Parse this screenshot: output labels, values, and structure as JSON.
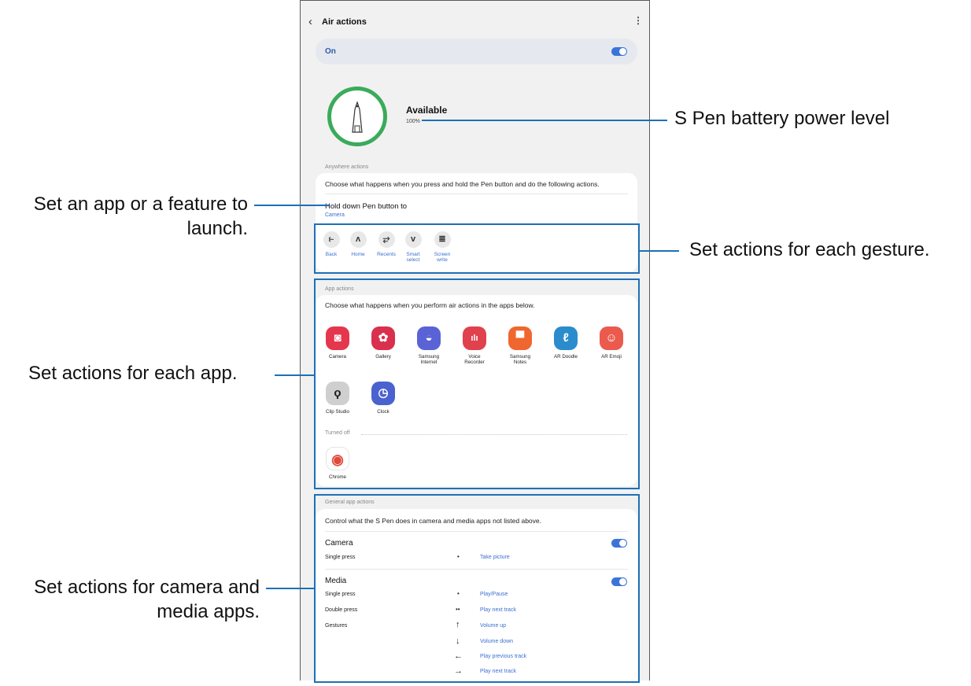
{
  "header": {
    "title": "Air actions"
  },
  "master_switch": {
    "label": "On",
    "state": true
  },
  "battery": {
    "status": "Available",
    "percent": "100%"
  },
  "anywhere": {
    "section_title": "Anywhere actions",
    "description": "Choose what happens when you press and hold the Pen button and do the following actions.",
    "hold_title": "Hold down Pen button to",
    "hold_value": "Camera",
    "gestures": [
      {
        "icon": "back-gesture-icon",
        "glyph": "⥼",
        "label": "Back"
      },
      {
        "icon": "home-gesture-icon",
        "glyph": "ʌ",
        "label": "Home"
      },
      {
        "icon": "recents-gesture-icon",
        "glyph": "⥂",
        "label": "Recents"
      },
      {
        "icon": "smart-select-gesture-icon",
        "glyph": "v",
        "label": "Smart select"
      },
      {
        "icon": "screen-write-gesture-icon",
        "glyph": "≣",
        "label": "Screen write"
      }
    ]
  },
  "app_actions": {
    "section_title": "App actions",
    "description": "Choose what happens when you perform air actions in the apps below.",
    "apps": [
      {
        "name": "Camera",
        "icon": "camera-icon",
        "color": "#e5364e",
        "glyph": "◙"
      },
      {
        "name": "Gallery",
        "icon": "gallery-icon",
        "color": "#d8304d",
        "glyph": "✿"
      },
      {
        "name": "Samsung Internet",
        "icon": "samsung-internet-icon",
        "color": "#5a63d6",
        "glyph": "◒"
      },
      {
        "name": "Voice Recorder",
        "icon": "voice-recorder-icon",
        "color": "#e0414d",
        "glyph": "ılı"
      },
      {
        "name": "Samsung Notes",
        "icon": "samsung-notes-icon",
        "color": "#f0662f",
        "glyph": "▀"
      },
      {
        "name": "AR Doodle",
        "icon": "ar-doodle-icon",
        "color": "#2a8ccc",
        "glyph": "ℓ"
      },
      {
        "name": "AR Emoji",
        "icon": "ar-emoji-icon",
        "color": "#ea5b4e",
        "glyph": "☺"
      },
      {
        "name": "Clip Studio",
        "icon": "clip-studio-icon",
        "color": "#cfcfcf",
        "glyph": "ϙ"
      },
      {
        "name": "Clock",
        "icon": "clock-icon",
        "color": "#4a62cf",
        "glyph": "◷"
      }
    ],
    "turned_off_label": "Turned off",
    "turned_off_apps": [
      {
        "name": "Chrome",
        "icon": "chrome-icon",
        "color": "#ffffff",
        "glyph": "◉"
      }
    ]
  },
  "general": {
    "section_title": "General app actions",
    "description": "Control what the S Pen does in camera and media apps not listed above.",
    "camera": {
      "title": "Camera",
      "state": true,
      "rows": [
        {
          "label": "Single press",
          "dots": "•",
          "value": "Take picture"
        }
      ]
    },
    "media": {
      "title": "Media",
      "state": true,
      "rows": [
        {
          "label": "Single press",
          "dots": "•",
          "value": "Play/Pause"
        },
        {
          "label": "Double press",
          "dots": "••",
          "value": "Play next track"
        },
        {
          "label": "Gestures",
          "dots": "↑",
          "value": "Volume up"
        },
        {
          "label": "",
          "dots": "↓",
          "value": "Volume down"
        },
        {
          "label": "",
          "dots": "←",
          "value": "Play previous track"
        },
        {
          "label": "",
          "dots": "→",
          "value": "Play next track"
        }
      ]
    }
  },
  "annotations": {
    "battery": "S Pen battery power level",
    "launch_line1": "Set an app or a feature to",
    "launch_line2": "launch.",
    "gesture": "Set actions for each gesture.",
    "app": "Set actions for each app.",
    "media_line1": "Set actions for camera and",
    "media_line2": "media apps."
  },
  "colors": {
    "accent": "#3a74d8",
    "callout": "#1d70b7",
    "battery_ring": "#3bab5b"
  }
}
